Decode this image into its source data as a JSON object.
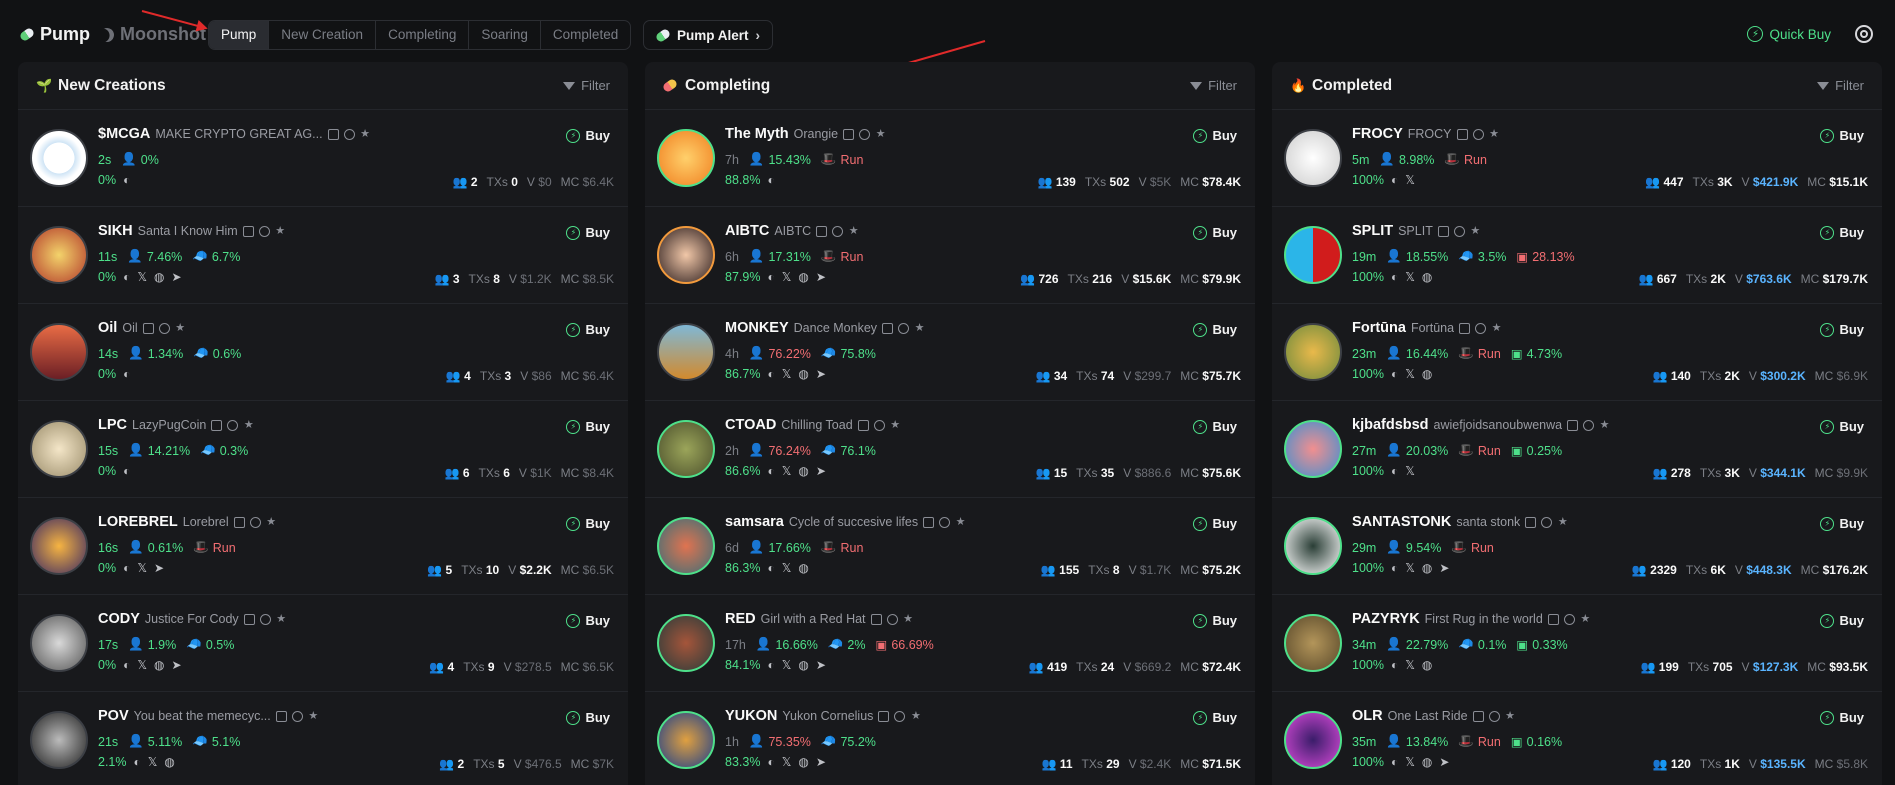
{
  "brand": {
    "pump": "Pump",
    "moonshot": "Moonshot"
  },
  "tabs": [
    "Pump",
    "New Creation",
    "Completing",
    "Soaring",
    "Completed"
  ],
  "alert_button": "Pump Alert",
  "quick_buy": "Quick Buy",
  "columns": [
    {
      "title": "New Creations",
      "filter": "Filter",
      "rows": [
        {
          "ticker": "$MCGA",
          "name": "MAKE CRYPTO GREAT AG...",
          "age": "2s",
          "s1": "0%",
          "s2": "",
          "bond": "0%",
          "holders": "2",
          "txs": "0",
          "vol": "$0",
          "mc": "$6.4K",
          "buy": "Buy"
        },
        {
          "ticker": "SIKH",
          "name": "Santa I Know Him",
          "age": "11s",
          "s1": "7.46%",
          "s2": "6.7%",
          "bond": "0%",
          "holders": "3",
          "txs": "8",
          "vol": "$1.2K",
          "mc": "$8.5K",
          "buy": "Buy"
        },
        {
          "ticker": "Oil",
          "name": "Oil",
          "age": "14s",
          "s1": "1.34%",
          "s2": "0.6%",
          "bond": "0%",
          "holders": "4",
          "txs": "3",
          "vol": "$86",
          "mc": "$6.4K",
          "buy": "Buy"
        },
        {
          "ticker": "LPC",
          "name": "LazyPugCoin",
          "age": "15s",
          "s1": "14.21%",
          "s2": "0.3%",
          "bond": "0%",
          "holders": "6",
          "txs": "6",
          "vol": "$1K",
          "mc": "$8.4K",
          "buy": "Buy"
        },
        {
          "ticker": "LOREBREL",
          "name": "Lorebrel",
          "age": "16s",
          "s1": "0.61%",
          "s2": "Run",
          "bond": "0%",
          "holders": "5",
          "txs": "10",
          "vol": "$2.2K",
          "mc": "$6.5K",
          "buy": "Buy"
        },
        {
          "ticker": "CODY",
          "name": "Justice For Cody",
          "age": "17s",
          "s1": "1.9%",
          "s2": "0.5%",
          "bond": "0%",
          "holders": "4",
          "txs": "9",
          "vol": "$278.5",
          "mc": "$6.5K",
          "buy": "Buy"
        },
        {
          "ticker": "POV",
          "name": "You beat the memecyc...",
          "age": "21s",
          "s1": "5.11%",
          "s2": "5.1%",
          "bond": "2.1%",
          "holders": "2",
          "txs": "5",
          "vol": "$476.5",
          "mc": "$7K",
          "buy": "Buy"
        }
      ]
    },
    {
      "title": "Completing",
      "filter": "Filter",
      "rows": [
        {
          "ticker": "The Myth",
          "name": "Orangie",
          "age": "7h",
          "s1": "15.43%",
          "s2": "Run",
          "bond": "88.8%",
          "holders": "139",
          "txs": "502",
          "vol": "$5K",
          "mc": "$78.4K",
          "buy": "Buy"
        },
        {
          "ticker": "AIBTC",
          "name": "AIBTC",
          "age": "6h",
          "s1": "17.31%",
          "s2": "Run",
          "bond": "87.9%",
          "holders": "726",
          "txs": "216",
          "vol": "$15.6K",
          "mc": "$79.9K",
          "buy": "Buy"
        },
        {
          "ticker": "MONKEY",
          "name": "Dance Monkey",
          "age": "4h",
          "s1": "76.22%",
          "s2": "75.8%",
          "bond": "86.7%",
          "holders": "34",
          "txs": "74",
          "vol": "$299.7",
          "mc": "$75.7K",
          "buy": "Buy"
        },
        {
          "ticker": "CTOAD",
          "name": "Chilling Toad",
          "age": "2h",
          "s1": "76.24%",
          "s2": "76.1%",
          "bond": "86.6%",
          "holders": "15",
          "txs": "35",
          "vol": "$886.6",
          "mc": "$75.6K",
          "buy": "Buy"
        },
        {
          "ticker": "samsara",
          "name": "Cycle of succesive lifes",
          "age": "6d",
          "s1": "17.66%",
          "s2": "Run",
          "bond": "86.3%",
          "holders": "155",
          "txs": "8",
          "vol": "$1.7K",
          "mc": "$75.2K",
          "buy": "Buy"
        },
        {
          "ticker": "RED",
          "name": "Girl with a Red Hat",
          "age": "17h",
          "s1": "16.66%",
          "s2": "2%",
          "s3": "66.69%",
          "bond": "84.1%",
          "holders": "419",
          "txs": "24",
          "vol": "$669.2",
          "mc": "$72.4K",
          "buy": "Buy"
        },
        {
          "ticker": "YUKON",
          "name": "Yukon Cornelius",
          "age": "1h",
          "s1": "75.35%",
          "s2": "75.2%",
          "bond": "83.3%",
          "holders": "11",
          "txs": "29",
          "vol": "$2.4K",
          "mc": "$71.5K",
          "buy": "Buy"
        }
      ]
    },
    {
      "title": "Completed",
      "filter": "Filter",
      "rows": [
        {
          "ticker": "FROCY",
          "name": "FROCY",
          "age": "5m",
          "s1": "8.98%",
          "s2": "Run",
          "bond": "100%",
          "holders": "447",
          "txs": "3K",
          "vol": "$421.9K",
          "mc": "$15.1K",
          "buy": "Buy"
        },
        {
          "ticker": "SPLIT",
          "name": "SPLIT",
          "age": "19m",
          "s1": "18.55%",
          "s2": "3.5%",
          "s3": "28.13%",
          "bond": "100%",
          "holders": "667",
          "txs": "2K",
          "vol": "$763.6K",
          "mc": "$179.7K",
          "buy": "Buy"
        },
        {
          "ticker": "Fortūna",
          "name": "Fortūna",
          "age": "23m",
          "s1": "16.44%",
          "s2": "Run",
          "s3": "4.73%",
          "bond": "100%",
          "holders": "140",
          "txs": "2K",
          "vol": "$300.2K",
          "mc": "$6.9K",
          "buy": "Buy"
        },
        {
          "ticker": "kjbafdsbsd",
          "name": "awiefjoidsanoubwenwa",
          "age": "27m",
          "s1": "20.03%",
          "s2": "Run",
          "s3": "0.25%",
          "bond": "100%",
          "holders": "278",
          "txs": "3K",
          "vol": "$344.1K",
          "mc": "$9.9K",
          "buy": "Buy"
        },
        {
          "ticker": "SANTASTONK",
          "name": "santa stonk",
          "age": "29m",
          "s1": "9.54%",
          "s2": "Run",
          "bond": "100%",
          "holders": "2329",
          "txs": "6K",
          "vol": "$448.3K",
          "mc": "$176.2K",
          "buy": "Buy"
        },
        {
          "ticker": "PAZYRYK",
          "name": "First Rug in the world",
          "age": "34m",
          "s1": "22.79%",
          "s2": "0.1%",
          "s3": "0.33%",
          "bond": "100%",
          "holders": "199",
          "txs": "705",
          "vol": "$127.3K",
          "mc": "$93.5K",
          "buy": "Buy"
        },
        {
          "ticker": "OLR",
          "name": "One Last Ride",
          "age": "35m",
          "s1": "13.84%",
          "s2": "Run",
          "s3": "0.16%",
          "bond": "100%",
          "holders": "120",
          "txs": "1K",
          "vol": "$135.5K",
          "mc": "$5.8K",
          "buy": "Buy"
        }
      ]
    }
  ],
  "metric_labels": {
    "txs": "TXs",
    "vol": "V",
    "mc": "MC"
  },
  "colors": {
    "accent_green": "#4ee08a",
    "run_red": "#f26e72",
    "vol_blue": "#5ab4ff",
    "annotation_red": "#e02a2a"
  }
}
